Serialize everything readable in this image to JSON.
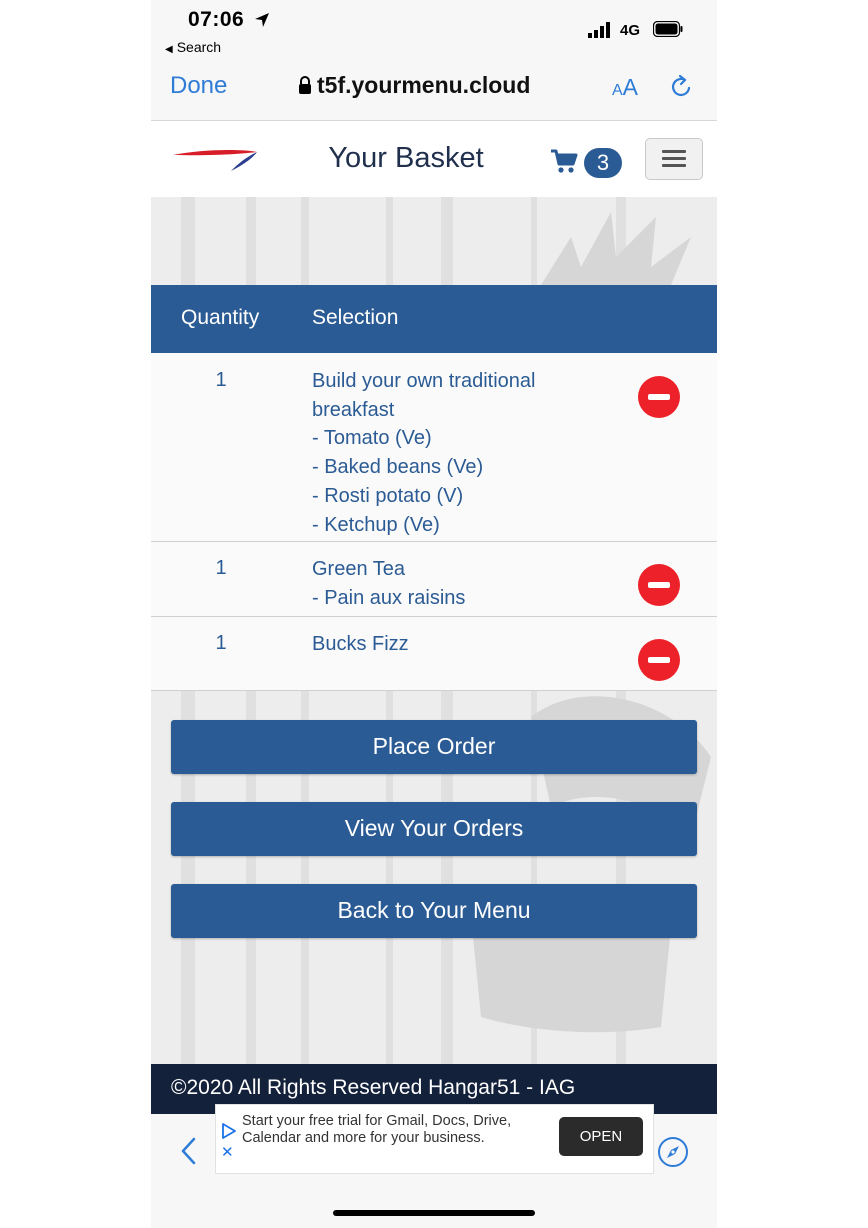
{
  "status_bar": {
    "time": "07:06",
    "back_app": "Search",
    "network": "4G"
  },
  "browser": {
    "done_label": "Done",
    "url": "t5f.yourmenu.cloud",
    "aa_small": "A",
    "aa_large": "A"
  },
  "header": {
    "title": "Your Basket",
    "cart_count": "3"
  },
  "table": {
    "headers": {
      "quantity": "Quantity",
      "selection": "Selection"
    },
    "rows": [
      {
        "quantity": "1",
        "lines": [
          "Build your own traditional",
          "breakfast",
          "- Tomato (Ve)",
          "- Baked beans (Ve)",
          "- Rosti potato (V)",
          "- Ketchup (Ve)"
        ]
      },
      {
        "quantity": "1",
        "lines": [
          "Green Tea",
          "- Pain aux raisins"
        ]
      },
      {
        "quantity": "1",
        "lines": [
          "Bucks Fizz"
        ]
      }
    ]
  },
  "actions": {
    "place_order": "Place Order",
    "view_orders": "View Your Orders",
    "back_to_menu": "Back to Your Menu"
  },
  "footer": {
    "text": "©2020 All Rights Reserved Hangar51 - IAG"
  },
  "ad": {
    "text_line1": "Start your free trial for Gmail, Docs, Drive,",
    "text_line2": "Calendar and more for your business.",
    "open_label": "OPEN"
  },
  "colors": {
    "primary": "#2b5b94",
    "footer_bg": "#14213b",
    "remove": "#ed2129",
    "ios_blue": "#2f7cd6"
  },
  "icons": [
    "location-arrow-icon",
    "signal-icon",
    "battery-icon",
    "lock-icon",
    "reload-icon",
    "cart-icon",
    "hamburger-menu-icon",
    "remove-item-icon",
    "back-chevron-icon",
    "ad-choices-icon",
    "close-ad-icon",
    "compass-icon"
  ]
}
